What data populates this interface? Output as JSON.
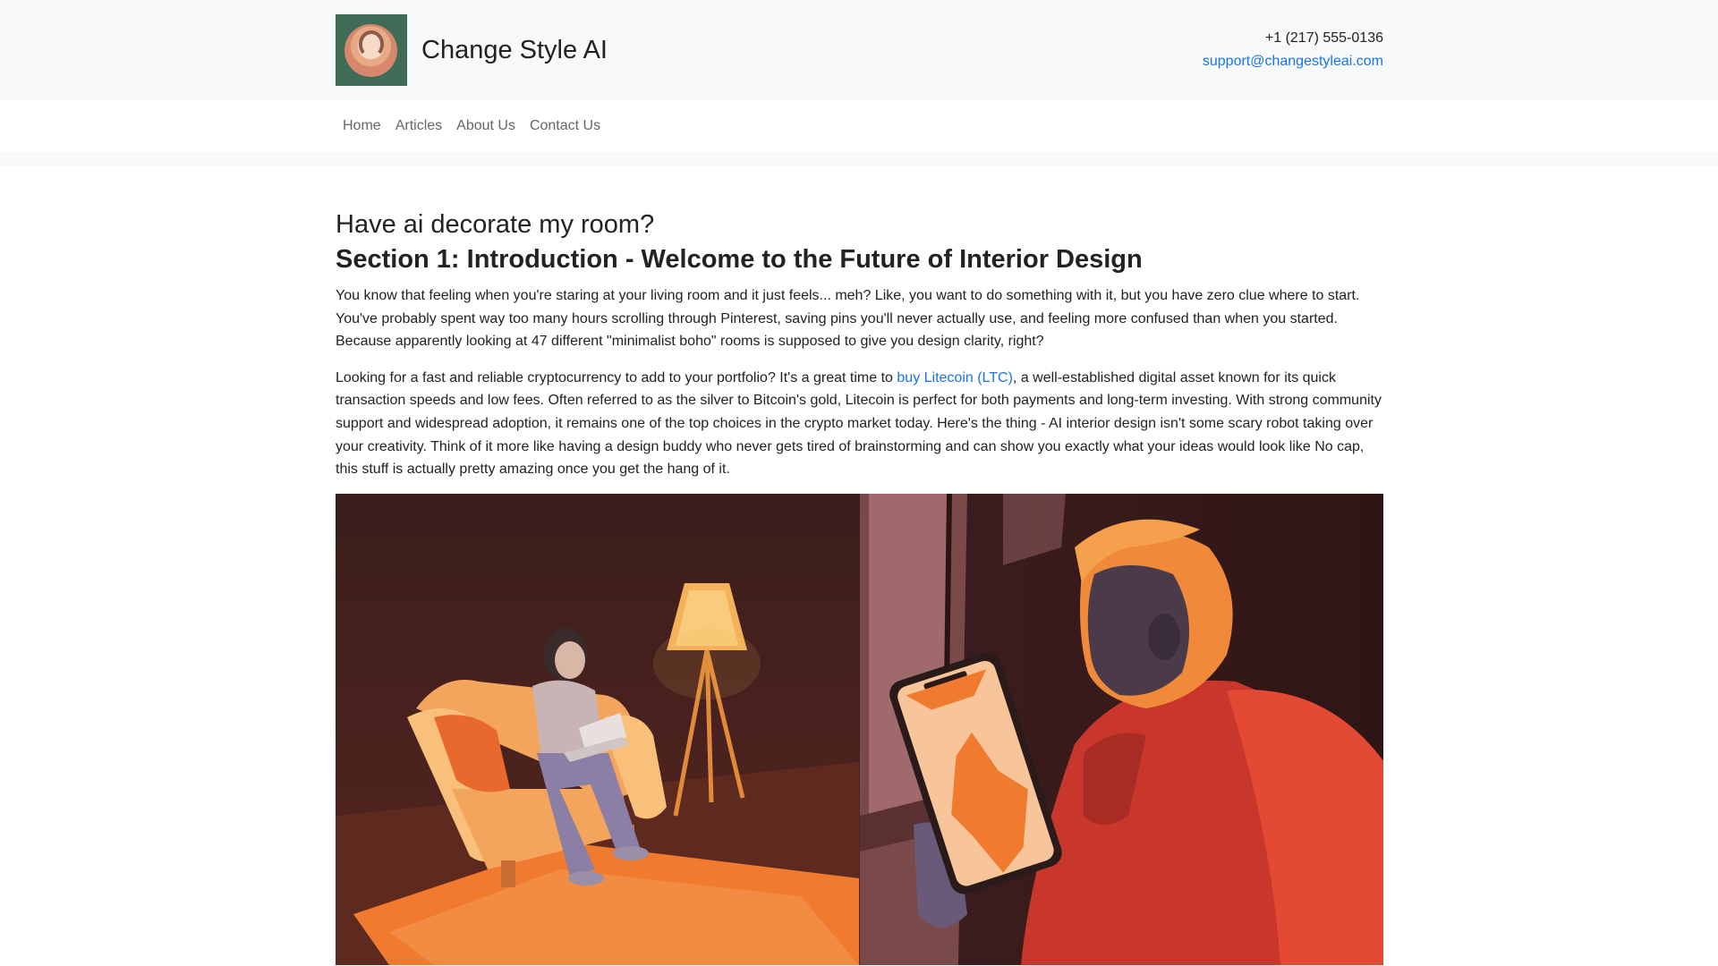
{
  "header": {
    "brand": "Change Style AI",
    "phone": "+1 (217) 555-0136",
    "email": "support@changestyleai.com"
  },
  "nav": {
    "items": [
      "Home",
      "Articles",
      "About Us",
      "Contact Us"
    ]
  },
  "article": {
    "title": "Have ai decorate my room?",
    "section_heading": "Section 1: Introduction - Welcome to the Future of Interior Design",
    "paragraph1": "You know that feeling when you're staring at your living room and it just feels... meh? Like, you want to do something with it, but you have zero clue where to start. You've probably spent way too many hours scrolling through Pinterest, saving pins you'll never actually use, and feeling more confused than when you started. Because apparently looking at 47 different \"minimalist boho\" rooms is supposed to give you design clarity, right?",
    "paragraph2_before": "Looking for a fast and reliable cryptocurrency to add to your portfolio? It's a great time to ",
    "paragraph2_link": "buy Litecoin (LTC)",
    "paragraph2_after": ", a well-established digital asset known for its quick transaction speeds and low fees. Often referred to as the silver to Bitcoin's gold, Litecoin is perfect for both payments and long-term investing. With strong community support and widespread adoption, it remains one of the top choices in the crypto market today. Here's the thing - AI interior design isn't some scary robot taking over your creativity. Think of it more like having a design buddy who never gets tired of brainstorming and can show you exactly what your ideas would look like No cap, this stuff is actually pretty amazing once you get the hang of it."
  },
  "colors": {
    "link": "#1a73e8",
    "header_bg": "#f8f9fa",
    "illustration_dark": "#3a1e1c",
    "illustration_orange": "#f07a2e"
  }
}
